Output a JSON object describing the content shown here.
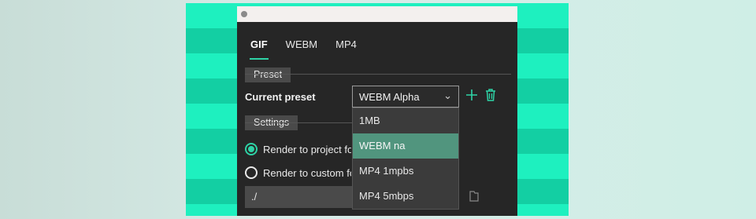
{
  "tabs": [
    {
      "label": "GIF",
      "active": true
    },
    {
      "label": "WEBM",
      "active": false
    },
    {
      "label": "MP4",
      "active": false
    }
  ],
  "preset": {
    "section_label": "Preset",
    "current_label": "Current preset",
    "selected_value": "WEBM Alpha",
    "options": [
      "1MB",
      "WEBM na",
      "MP4 1mpbs",
      "MP4 5mbps"
    ],
    "highlighted_option": "WEBM na"
  },
  "settings": {
    "section_label": "Settings",
    "radio_project": "Render to project fol",
    "radio_custom": "Render to custom fo",
    "path_value": "./"
  },
  "colors": {
    "accent": "#2ed3a6",
    "background": "#262626",
    "stripe_light": "#1ef0bf",
    "stripe_dark": "#13cfa3"
  },
  "icons": [
    "add-icon",
    "trash-icon",
    "chevron-down-icon",
    "folder-icon",
    "window-dot-icon"
  ]
}
